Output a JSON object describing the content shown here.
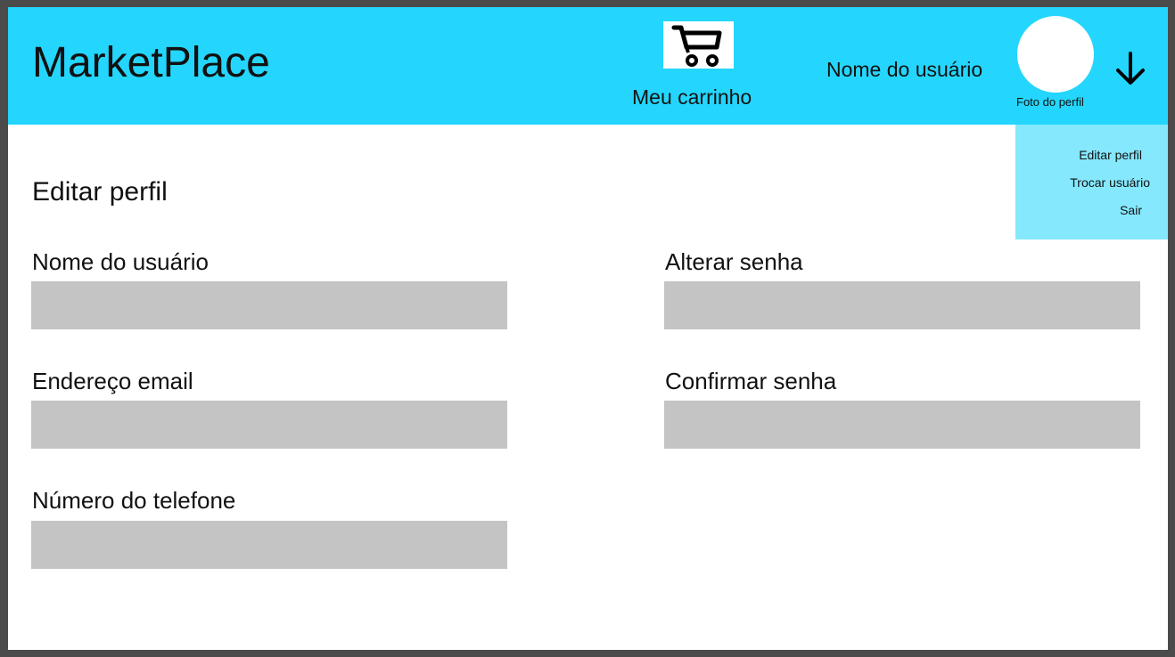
{
  "header": {
    "brand": "MarketPlace",
    "cart_label": "Meu carrinho",
    "cart_icon": "shopping-cart-icon",
    "user_name": "Nome do usuário",
    "avatar_caption": "Foto do perfil",
    "menu_icon": "arrow-down-icon",
    "background_color": "#24d6fd"
  },
  "dropdown": {
    "background_color": "#85e8fc",
    "items": [
      {
        "label": "Editar perfil"
      },
      {
        "label": "Trocar usuário"
      },
      {
        "label": "Sair"
      }
    ]
  },
  "form": {
    "title": "Editar perfil",
    "input_color": "#c4c4c4",
    "fields": {
      "username": {
        "label": "Nome do usuário",
        "value": ""
      },
      "email": {
        "label": "Endereço email",
        "value": ""
      },
      "phone": {
        "label": "Número do telefone",
        "value": ""
      },
      "new_password": {
        "label": "Alterar senha",
        "value": ""
      },
      "confirm_password": {
        "label": "Confirmar senha",
        "value": ""
      }
    }
  }
}
